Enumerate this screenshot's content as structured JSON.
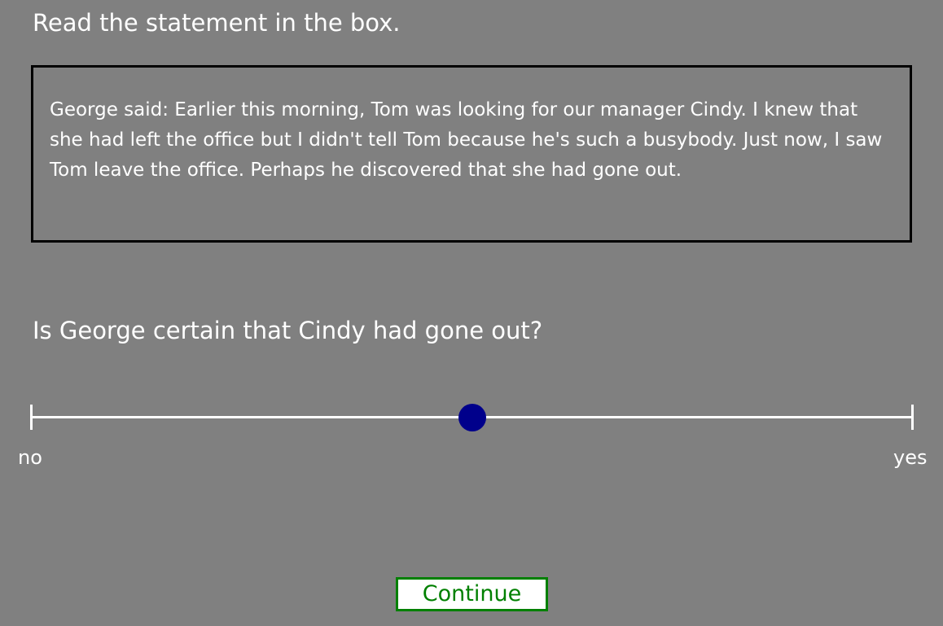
{
  "instruction": "Read the statement in the box.",
  "statement": "George said: Earlier this morning, Tom was looking for our manager Cindy. I knew that she had left the office but I didn't tell Tom because he's such a busybody. Just now, I saw Tom leave the office. Perhaps he discovered that she had gone out.",
  "question": "Is George certain that Cindy had gone out?",
  "slider": {
    "min_label": "no",
    "max_label": "yes",
    "value_fraction": 0.5,
    "thumb_color": "#00008b"
  },
  "continue_button": {
    "label": "Continue",
    "color": "#008000"
  },
  "colors": {
    "background": "#808080",
    "text": "#ffffff",
    "box_border": "#000000"
  }
}
